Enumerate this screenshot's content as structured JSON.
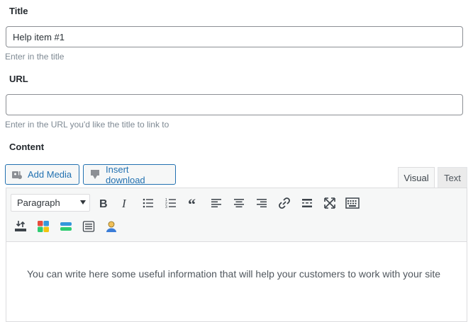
{
  "title_field": {
    "label": "Title",
    "value": "Help item #1",
    "hint": "Enter in the title"
  },
  "url_field": {
    "label": "URL",
    "value": "",
    "hint": "Enter in the URL you'd like the title to link to"
  },
  "content_field": {
    "label": "Content"
  },
  "media_buttons": {
    "add_media": "Add Media",
    "insert_download": "Insert download"
  },
  "editor_tabs": {
    "visual": "Visual",
    "text": "Text"
  },
  "toolbar": {
    "format_select": "Paragraph",
    "row1_icons": [
      "bold-icon",
      "italic-icon",
      "bullet-list-icon",
      "numbered-list-icon",
      "blockquote-icon",
      "align-left-icon",
      "align-center-icon",
      "align-right-icon",
      "link-icon",
      "read-more-icon",
      "fullscreen-icon",
      "toolbar-toggle-icon"
    ],
    "row2_icons": [
      "shortcode-insert-icon",
      "color-grid-icon",
      "divider-icon",
      "list-box-icon",
      "user-icon"
    ]
  },
  "editor_content": "You can write here some useful information that will help your customers to work with your site",
  "colors": {
    "accent": "#2271b1",
    "border": "#8c8f94",
    "hint": "#7e8993"
  }
}
